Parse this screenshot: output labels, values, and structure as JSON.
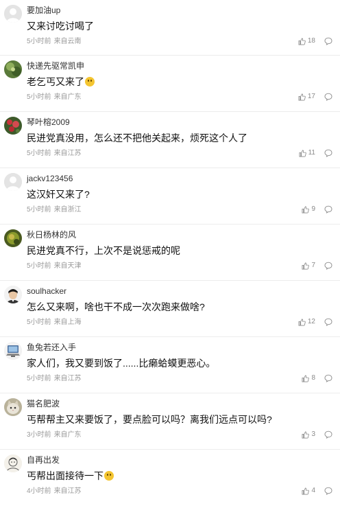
{
  "meta_suffix_time_label": "",
  "comments": [
    {
      "username": "要加油up",
      "content": "又来讨吃讨喝了",
      "time": "5小时前",
      "location": "来自云南",
      "likes": "18",
      "avatar": "default",
      "emoji": false
    },
    {
      "username": "快递先驱常凯申",
      "content": "老乞丐又来了",
      "time": "5小时前",
      "location": "来自广东",
      "likes": "17",
      "avatar": "green",
      "emoji": true
    },
    {
      "username": "琴叶榕2009",
      "content": "民进党真没用，怎么还不把他关起来，烦死这个人了",
      "time": "5小时前",
      "location": "来自江苏",
      "likes": "11",
      "avatar": "flower",
      "emoji": false
    },
    {
      "username": "jackv123456",
      "content": "这汉奸又来了?",
      "time": "5小时前",
      "location": "来自浙江",
      "likes": "9",
      "avatar": "default",
      "emoji": false
    },
    {
      "username": "秋日杨林的风",
      "content": "民进党真不行，上次不是说惩戒的呢",
      "time": "5小时前",
      "location": "来自天津",
      "likes": "7",
      "avatar": "leaf",
      "emoji": false
    },
    {
      "username": "soulhacker",
      "content": "怎么又来啊，啥也干不成一次次跑来做啥?",
      "time": "5小时前",
      "location": "来自上海",
      "likes": "12",
      "avatar": "person",
      "emoji": false
    },
    {
      "username": "鱼兔若还入手",
      "content": "家人们，我又要到饭了......比癞蛤蟆更恶心。",
      "time": "5小时前",
      "location": "来自江苏",
      "likes": "8",
      "avatar": "computer",
      "emoji": false
    },
    {
      "username": "猫名肥波",
      "content": "丐帮帮主又来要饭了，要点脸可以吗？离我们远点可以吗?",
      "time": "3小时前",
      "location": "来自广东",
      "likes": "3",
      "avatar": "cat",
      "emoji": false
    },
    {
      "username": "自再出发",
      "content": "丐帮出面接待一下",
      "time": "4小时前",
      "location": "来自江苏",
      "likes": "4",
      "avatar": "sketch",
      "emoji": true
    }
  ],
  "icons": {
    "like": "thumbs-up-icon",
    "reply": "comment-bubble-icon"
  },
  "colors": {
    "meta": "#999999",
    "divider": "#ececec",
    "text": "#111111"
  }
}
